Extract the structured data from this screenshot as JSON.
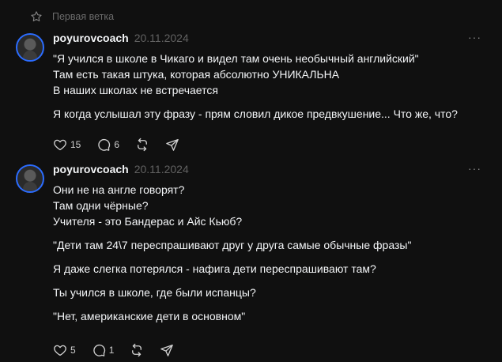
{
  "thread": {
    "title": "Первая ветка"
  },
  "posts": [
    {
      "username": "poyurovcoach",
      "timestamp": "20.11.2024",
      "lines": [
        "\"Я учился в школе в Чикаго и видел там очень необычный английский\"",
        "Там есть такая штука, которая абсолютно УНИКАЛЬНА",
        "В наших школах не встречается",
        "",
        "Я когда услышал эту фразу - прям словил дикое предвкушение... Что же, что?"
      ],
      "likes": "15",
      "replies": "6"
    },
    {
      "username": "poyurovcoach",
      "timestamp": "20.11.2024",
      "lines": [
        "Они не на англе говорят?",
        "Там одни чёрные?",
        "Учителя - это Бандерас и Айс Кьюб?",
        "",
        "\"Дети там 24\\7 переспрашивают друг у друга самые обычные фразы\"",
        "",
        "Я даже слегка потерялся - нафига дети переспрашивают там?",
        "",
        "Ты учился в школе, где были испанцы?",
        "",
        "\"Нет, американские дети в основном\""
      ],
      "likes": "5",
      "replies": "1"
    }
  ],
  "icons": {
    "thread": "star-icon",
    "avatar": "avatar",
    "more": "more-dots-icon",
    "like": "heart-icon",
    "reply": "comment-icon",
    "repost": "repost-icon",
    "share": "send-icon"
  },
  "colors": {
    "background": "#101010",
    "text": "#f3f5f7",
    "muted": "#616161",
    "avatar_ring": "#2b6cff"
  }
}
